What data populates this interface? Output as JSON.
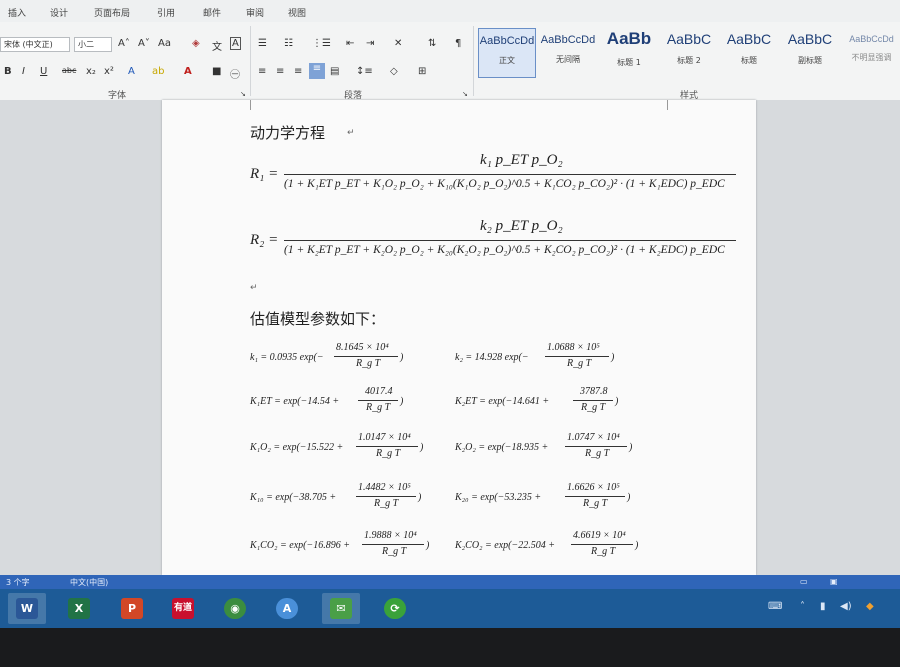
{
  "ribbon_tabs": [
    "插入",
    "设计",
    "页面布局",
    "引用",
    "邮件",
    "审阅",
    "视图"
  ],
  "font": {
    "name": "宋体 (中文正)",
    "size": "小二",
    "group_label": "字体"
  },
  "paragraph": {
    "group_label": "段落"
  },
  "styles": {
    "group_label": "样式",
    "items": [
      {
        "sample": "AaBbCcDd",
        "name": "正文"
      },
      {
        "sample": "AaBbCcDd",
        "name": "无间隔"
      },
      {
        "sample": "AaBb",
        "name": "标题 1"
      },
      {
        "sample": "AaBbC",
        "name": "标题 2"
      },
      {
        "sample": "AaBbC",
        "name": "标题"
      },
      {
        "sample": "AaBbC",
        "name": "副标题"
      },
      {
        "sample": "AaBbCcDd",
        "name": "不明显强调"
      }
    ]
  },
  "document": {
    "heading1": "动力学方程",
    "heading2": "估值模型参数如下：",
    "eq_R1": {
      "lhs": "R₁ =",
      "numerator": "k₁ p_ET p_O₂",
      "denominator": "(1 + K₁ET p_ET + K₁O₂ p_O₂ + K₁₀(K₁O₂ p_O₂)^0.5 + K₁CO₂ p_CO₂)² · (1 + K₁EDC) p_EDC"
    },
    "eq_R2": {
      "lhs": "R₂ =",
      "numerator": "k₂ p_ET p_O₂",
      "denominator": "(1 + K₂ET p_ET + K₂O₂ p_O₂ + K₂₀(K₂O₂ p_O₂)^0.5 + K₂CO₂ p_CO₂)² · (1 + K₂EDC) p_EDC"
    },
    "params": [
      {
        "lhs": "k₁ = 0.0935 exp(−",
        "num": "8.1645 × 10⁴",
        "den": "R_g T",
        "tail": ")"
      },
      {
        "lhs": "k₂ = 14.928 exp(−",
        "num": "1.0688 × 10⁵",
        "den": "R_g T",
        "tail": ")"
      },
      {
        "lhs": "K₁ET = exp(−14.54 +",
        "num": "4017.4",
        "den": "R_g T",
        "tail": ")"
      },
      {
        "lhs": "K₂ET = exp(−14.641 +",
        "num": "3787.8",
        "den": "R_g T",
        "tail": ")"
      },
      {
        "lhs": "K₁O₂ = exp(−15.522 +",
        "num": "1.0147 × 10⁴",
        "den": "R_g T",
        "tail": ")"
      },
      {
        "lhs": "K₂O₂ = exp(−18.935 +",
        "num": "1.0747 × 10⁴",
        "den": "R_g T",
        "tail": ")"
      },
      {
        "lhs": "K₁₀ = exp(−38.705 +",
        "num": "1.4482 × 10⁵",
        "den": "R_g T",
        "tail": ")"
      },
      {
        "lhs": "K₂₀ = exp(−53.235 +",
        "num": "1.6626 × 10⁵",
        "den": "R_g T",
        "tail": ")"
      },
      {
        "lhs": "K₁CO₂ = exp(−16.896 +",
        "num": "1.9888 × 10⁴",
        "den": "R_g T",
        "tail": ")"
      },
      {
        "lhs": "K₂CO₂ = exp(−22.504 +",
        "num": "4.6619 × 10⁴",
        "den": "R_g T",
        "tail": ")"
      }
    ]
  },
  "statusbar": {
    "words": "3 个字",
    "language": "中文(中国)"
  },
  "taskbar": {
    "apps": [
      {
        "name": "word-app-icon",
        "label": "W",
        "color": "#2b5797"
      },
      {
        "name": "excel-app-icon",
        "label": "X",
        "color": "#217346"
      },
      {
        "name": "powerpoint-app-icon",
        "label": "P",
        "color": "#d24726"
      },
      {
        "name": "youdao-app-icon",
        "label": "有道",
        "color": "#c8102e"
      },
      {
        "name": "chrome-app-icon",
        "label": "◉",
        "color": "#3b8d3f"
      },
      {
        "name": "atext-app-icon",
        "label": "A",
        "color": "#4a90d9"
      },
      {
        "name": "wechat-app-icon",
        "label": "✉",
        "color": "#4a9f47"
      },
      {
        "name": "360-app-icon",
        "label": "⟳",
        "color": "#3aa23a"
      }
    ]
  },
  "colors": {
    "ribbon_bg": "#f3f4f4",
    "statusbar": "#2f65b8",
    "taskbar": "#1d5b97"
  }
}
